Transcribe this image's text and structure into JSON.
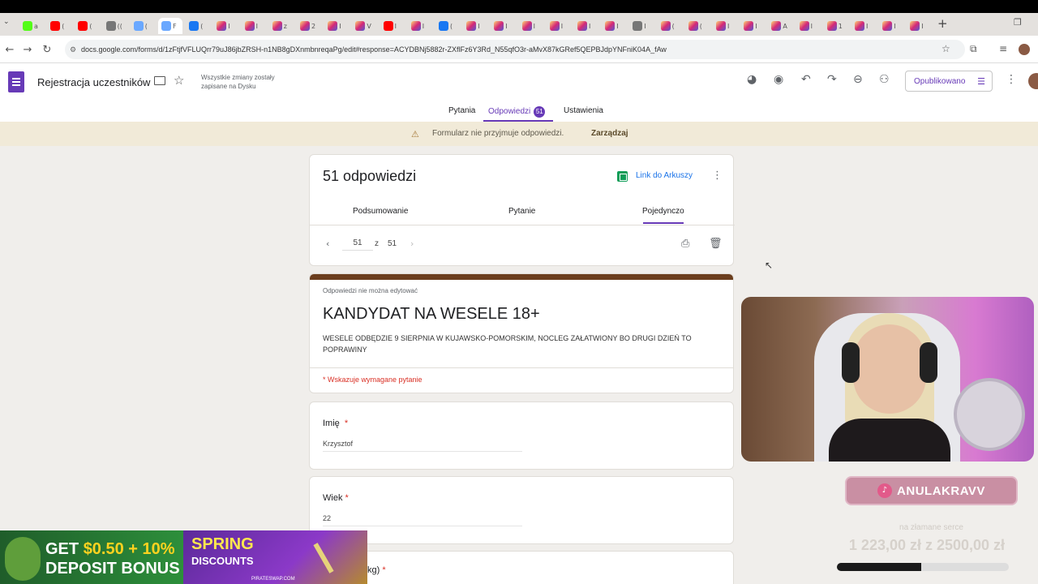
{
  "browser": {
    "tabs": [
      {
        "favicon": "kick-icon",
        "label": "a"
      },
      {
        "favicon": "youtube-icon",
        "label": "("
      },
      {
        "favicon": "youtube-icon",
        "label": "("
      },
      {
        "favicon": "audio-tab-icon",
        "label": "(("
      },
      {
        "favicon": "web-icon",
        "label": "("
      },
      {
        "favicon": "forms-icon",
        "label": "F"
      },
      {
        "favicon": "facebook-icon",
        "label": "("
      },
      {
        "favicon": "instagram-icon",
        "label": "I"
      },
      {
        "favicon": "instagram-icon",
        "label": "I"
      },
      {
        "favicon": "instagram-icon",
        "label": "z"
      },
      {
        "favicon": "instagram-icon",
        "label": "2"
      },
      {
        "favicon": "instagram-icon",
        "label": "I"
      },
      {
        "favicon": "instagram-icon",
        "label": "V"
      },
      {
        "favicon": "youtube-icon",
        "label": "I"
      },
      {
        "favicon": "instagram-icon",
        "label": "I"
      },
      {
        "favicon": "facebook-icon",
        "label": "("
      },
      {
        "favicon": "instagram-icon",
        "label": "I"
      },
      {
        "favicon": "instagram-icon",
        "label": "I"
      },
      {
        "favicon": "instagram-icon",
        "label": "I"
      },
      {
        "favicon": "instagram-icon",
        "label": "I"
      },
      {
        "favicon": "instagram-icon",
        "label": "I"
      },
      {
        "favicon": "instagram-icon",
        "label": "I"
      },
      {
        "favicon": "globe-icon",
        "label": "I"
      },
      {
        "favicon": "instagram-icon",
        "label": "("
      },
      {
        "favicon": "instagram-icon",
        "label": "("
      },
      {
        "favicon": "instagram-icon",
        "label": "I"
      },
      {
        "favicon": "instagram-icon",
        "label": "I"
      },
      {
        "favicon": "instagram-icon",
        "label": "A"
      },
      {
        "favicon": "instagram-icon",
        "label": "I"
      },
      {
        "favicon": "instagram-icon",
        "label": "1"
      },
      {
        "favicon": "instagram-icon",
        "label": "I"
      },
      {
        "favicon": "instagram-icon",
        "label": "I"
      },
      {
        "favicon": "instagram-icon",
        "label": "I"
      }
    ],
    "url": "docs.google.com/forms/d/1zFtjfVFLUQrr79uJ86jbZRSH-n1NB8gDXnmbnreqaPg/edit#response=ACYDBNj5882r-ZXflFz6Y3Rd_N55qfO3r-aMvX87kGRef5QEPBJdpYNFniK04A_fAw"
  },
  "forms": {
    "title": "Rejestracja uczestników",
    "save_status": "Wszystkie zmiany zostały zapisane na Dysku",
    "publish_label": "Opublikowano",
    "tabs": {
      "questions": "Pytania",
      "responses": "Odpowiedzi",
      "responses_count": "51",
      "settings": "Ustawienia"
    },
    "notice": {
      "message": "Formularz nie przyjmuje odpowiedzi.",
      "manage": "Zarządzaj"
    }
  },
  "summary": {
    "count_title": "51 odpowiedzi",
    "sheets_link": "Link do Arkuszy",
    "subtabs": {
      "summary": "Podsumowanie",
      "question": "Pytanie",
      "individual": "Pojedynczo"
    },
    "pager": {
      "current": "51",
      "of": "z",
      "total": "51"
    }
  },
  "form_header": {
    "noedit": "Odpowiedzi nie można edytować",
    "title": "KANDYDAT NA WESELE 18+",
    "description": "WESELE ODBĘDZIE 9 SIERPNIA W KUJAWSKO-POMORSKIM, NOCLEG ZAŁATWIONY BO DRUGI DZIEŃ TO POPRAWINY",
    "required_note": "* Wskazuje wymagane pytanie"
  },
  "questions": [
    {
      "label": "Imię",
      "required": "*",
      "answer": "Krzysztof"
    },
    {
      "label": "Wiek",
      "required": "*",
      "answer": "22"
    }
  ],
  "partial_question": {
    "label": "kg)",
    "required": "*"
  },
  "stream": {
    "tiktok_handle": "ANULAKRAVV",
    "goal_caption": "na złamane serce",
    "goal_amount": "1 223,00 zł z 2500,00 zł",
    "goal_progress": 0.489
  },
  "ads": {
    "left": {
      "line1_a": "GET",
      "line1_b": "$0.50 + 10%",
      "line2": "DEPOSIT BONUS"
    },
    "right": {
      "line1": "SPRING",
      "line2": "DISCOUNTS",
      "domain": "PIRATESWAP.COM"
    }
  }
}
